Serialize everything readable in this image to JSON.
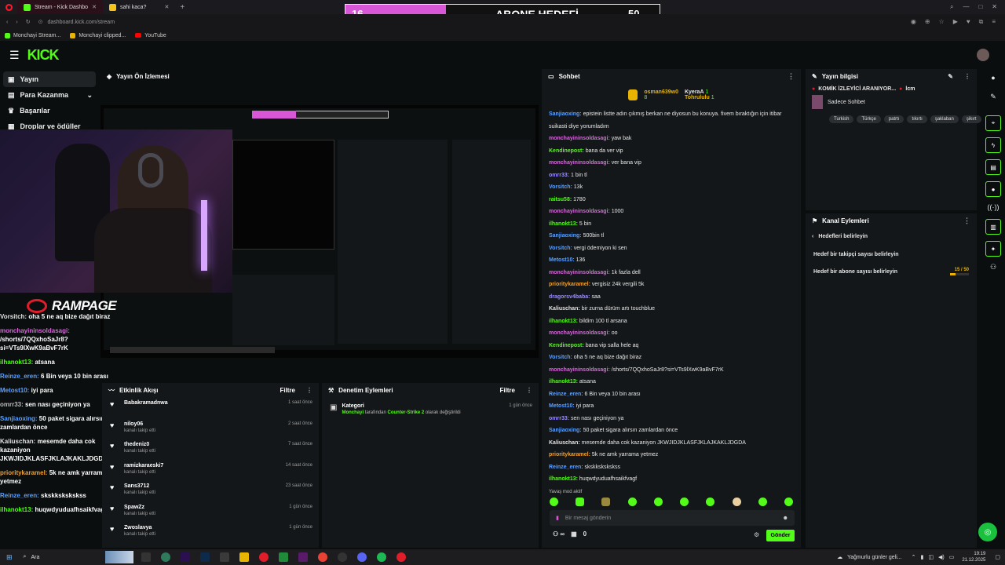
{
  "browser": {
    "tabs": [
      {
        "label": "Stream - Kick Dashbo"
      },
      {
        "label": "sahi kaca?"
      }
    ],
    "url": "dashboard.kick.com/stream",
    "bookmarks": [
      "Monchayi Stream...",
      "Monchayi clipped...",
      "YouTube"
    ]
  },
  "goal": {
    "current": "16",
    "label": "ABONE HEDEFİ",
    "target": "50",
    "progress": 0.32
  },
  "kick": {
    "logo": "KICK"
  },
  "sidebar": {
    "items": [
      {
        "label": "Yayın",
        "icon": "broadcast-icon"
      },
      {
        "label": "Para Kazanma",
        "icon": "money-icon"
      },
      {
        "label": "Başarılar",
        "icon": "trophy-icon"
      },
      {
        "label": "Droplar ve ödüller",
        "icon": "gift-icon"
      }
    ]
  },
  "preview": {
    "title": "Yayın Ön İzlemesi"
  },
  "overlay": {
    "brand": "RAMPAGE"
  },
  "overlay_chat": [
    {
      "user": "Vorsitch:",
      "msg": "oha 5 ne aq bize dağıt biraz",
      "color": "#e0e0e0"
    },
    {
      "user": "monchayininsoldasagi:",
      "msg": "/shorts/7QQxhoSaJr8?si=VTs9lXwK9aBvF7rK",
      "color": "#d36ad8"
    },
    {
      "user": "ilhanokt13:",
      "msg": "atsana",
      "color": "#53fc18"
    },
    {
      "user": "Reinze_eren:",
      "msg": "6 Bin veya 10 bin arası",
      "color": "#5aa0ff"
    },
    {
      "user": "Metost10:",
      "msg": "iyi para",
      "color": "#5aa0ff"
    },
    {
      "user": "omrr33:",
      "msg": "sen nası geçiniyon ya",
      "color": "#bbbbbb"
    },
    {
      "user": "Sanjiaoxing:",
      "msg": "50 paket sigara alırsın zamlardan önce",
      "color": "#5aa0ff"
    },
    {
      "user": "Kaliuschan:",
      "msg": "mesemde daha cok kazaniyon JKWJIDJKLASFJKLAJKAKLJDGDA",
      "color": "#e0e0e0"
    },
    {
      "user": "prioritykaramel:",
      "msg": "5k ne amk yarrama yetmez",
      "color": "#f0a030"
    },
    {
      "user": "Reinze_eren:",
      "msg": "skskkskskskss",
      "color": "#5aa0ff"
    },
    {
      "user": "ilhanokt13:",
      "msg": "huqwdyuduafhsaikfvagf",
      "color": "#53fc18"
    }
  ],
  "events": {
    "title": "Etkinlik Akışı",
    "filter": "Filtre",
    "items": [
      {
        "name": "Babakramadnwa",
        "sub": "",
        "time": "1 saat önce"
      },
      {
        "name": "niloy06",
        "sub": "kanalı takip etti",
        "time": "2 saat önce"
      },
      {
        "name": "thedeniz0",
        "sub": "kanalı takip etti",
        "time": "7 saat önce"
      },
      {
        "name": "ramizkaraeski7",
        "sub": "kanalı takip etti",
        "time": "14 saat önce"
      },
      {
        "name": "Sans3712",
        "sub": "kanalı takip etti",
        "time": "23 saat önce"
      },
      {
        "name": "SpawZz",
        "sub": "kanalı takip etti",
        "time": "1 gün önce"
      },
      {
        "name": "Zwoslavya",
        "sub": "kanalı takip etti",
        "time": "1 gün önce"
      }
    ]
  },
  "moderation": {
    "title": "Denetim Eylemleri",
    "filter": "Filtre",
    "item": {
      "title": "Kategori",
      "actor": "Monchayi",
      "text1": "tarafından",
      "highlight": "Counter-Strike 2",
      "text2": "olarak değiştirildi",
      "time": "1 gün önce"
    }
  },
  "chat": {
    "title": "Sohbet",
    "top": [
      {
        "name": "osman639w0",
        "count": "8"
      },
      {
        "name": "KyeraA",
        "count": "1"
      },
      {
        "name": "Tohrululu",
        "count": "1"
      }
    ],
    "messages": [
      {
        "user": "Sanjiaoxing:",
        "msg": "epistein listte adın çıkmış berkan ne diyosun bu konuya. fivem bıraktığın için itibar",
        "color": "#5aa0ff"
      },
      {
        "user": "",
        "msg": "suikasti diye yorumladım",
        "color": "#5aa0ff"
      },
      {
        "user": "monchayininsoldasagi:",
        "msg": "yaw bak",
        "color": "#d36ad8"
      },
      {
        "user": "Kendinepost:",
        "msg": "bana da ver vip",
        "color": "#53fc18"
      },
      {
        "user": "monchayininsoldasagi:",
        "msg": "ver bana vip",
        "color": "#d36ad8"
      },
      {
        "user": "omrr33:",
        "msg": "1 bin tl",
        "color": "#9a8cff"
      },
      {
        "user": "Vorsitch:",
        "msg": "13k",
        "color": "#5aa0ff"
      },
      {
        "user": "raitsu58:",
        "msg": "1780",
        "color": "#53fc18"
      },
      {
        "user": "monchayininsoldasagi:",
        "msg": "1000",
        "color": "#d36ad8"
      },
      {
        "user": "ilhanokt13:",
        "msg": "5 bin",
        "color": "#53fc18"
      },
      {
        "user": "Sanjiaoxing:",
        "msg": "500bin tl",
        "color": "#5aa0ff"
      },
      {
        "user": "Vorsitch:",
        "msg": "vergi ödemiyon ki sen",
        "color": "#5aa0ff"
      },
      {
        "user": "Metost10:",
        "msg": "136",
        "color": "#5aa0ff"
      },
      {
        "user": "monchayininsoldasagi:",
        "msg": "1k fazla dell",
        "color": "#d36ad8"
      },
      {
        "user": "prioritykaramel:",
        "msg": "vergisiz 24k vergili 5k",
        "color": "#f0a030"
      },
      {
        "user": "dragorsv4baba:",
        "msg": "saa",
        "color": "#9a8cff"
      },
      {
        "user": "Kaliuschan:",
        "msg": "bir zurna dürüm artı touchblue",
        "color": "#e0e0e0"
      },
      {
        "user": "ilhanokt13:",
        "msg": "bildim 100 tl arsana",
        "color": "#53fc18"
      },
      {
        "user": "monchayininsoldasagi:",
        "msg": "oo",
        "color": "#d36ad8"
      },
      {
        "user": "Kendinepost:",
        "msg": "bana vip salla hele aq",
        "color": "#53fc18"
      },
      {
        "user": "Vorsitch:",
        "msg": "oha 5 ne aq bize dağıt biraz",
        "color": "#5aa0ff"
      },
      {
        "user": "monchayininsoldasagi:",
        "msg": "/shorts/7QQxhoSaJr8?si=VTs9lXwK9aBvF7rK",
        "color": "#d36ad8"
      },
      {
        "user": "ilhanokt13:",
        "msg": "atsana",
        "color": "#53fc18"
      },
      {
        "user": "Reinze_eren:",
        "msg": "6 Bin veya 10 bin arası",
        "color": "#5aa0ff"
      },
      {
        "user": "Metost10:",
        "msg": "iyi para",
        "color": "#5aa0ff"
      },
      {
        "user": "omrr33:",
        "msg": "sen nası geçiniyon ya",
        "color": "#9a8cff"
      },
      {
        "user": "Sanjiaoxing:",
        "msg": "50 paket sigara alırsın zamlardan önce",
        "color": "#5aa0ff"
      },
      {
        "user": "Kaliuschan:",
        "msg": "mesemde daha cok kazaniyon JKWJIDJKLASFJKLAJKAKLJDGDA",
        "color": "#e0e0e0"
      },
      {
        "user": "prioritykaramel:",
        "msg": "5k ne amk yarrama yetmez",
        "color": "#f0a030"
      },
      {
        "user": "Reinze_eren:",
        "msg": "skskkskskskss",
        "color": "#5aa0ff"
      },
      {
        "user": "ilhanokt13:",
        "msg": "huqwdyuduafhsaikfvagf",
        "color": "#53fc18"
      }
    ],
    "slow_mode": "Yavaş mod aktif",
    "placeholder": "Bir mesaj gönderin",
    "viewer_count": "0",
    "send": "Gönder"
  },
  "stream_info": {
    "title": "Yayın bilgisi",
    "stream_title": "KOMİK İZLEYİCİ ARANIYOR...",
    "stream_title_suffix": "lcm",
    "category": "Sadece Sohbet",
    "tags": [
      "Turkish",
      "Türkçe",
      "patrtı",
      "tıkırtı",
      "şaklaban",
      "şikırt"
    ]
  },
  "channel_actions": {
    "title": "Kanal Eylemleri",
    "back": "Hedefleri belirleyin",
    "items": [
      {
        "label": "Hedef bir takipçi sayısı belirleyin",
        "value": ""
      },
      {
        "label": "Hedef bir abone sayısı belirleyin",
        "value": "15 / 50",
        "progress": 0.3
      }
    ]
  },
  "taskbar": {
    "search": "Ara",
    "weather": "Yağmurlu günler geli...",
    "time": "19:19",
    "date": "21.12.2025"
  }
}
